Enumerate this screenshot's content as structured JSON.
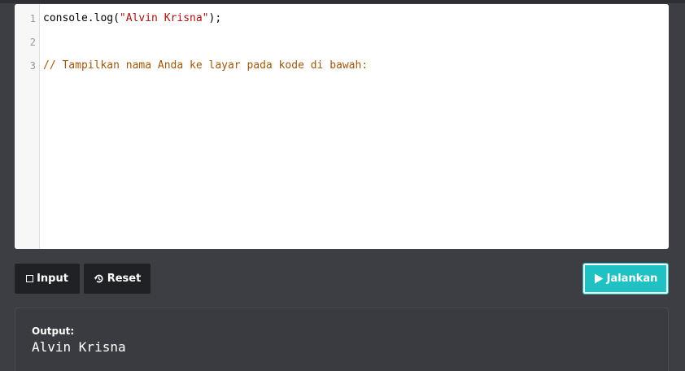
{
  "editor": {
    "lines": [
      {
        "number": "1",
        "code_prefix": "console.log(",
        "code_string": "\"Alvin Krisna\"",
        "code_suffix": ");"
      },
      {
        "number": "2"
      },
      {
        "number": "3",
        "comment": "// Tampilkan nama Anda ke layar pada kode di bawah:"
      }
    ]
  },
  "toolbar": {
    "input_label": "Input",
    "reset_label": "Reset",
    "run_label": "Jalankan"
  },
  "output": {
    "label": "Output:",
    "text": "Alvin Krisna"
  },
  "icons": {
    "input": "square-icon",
    "reset": "history-icon",
    "run": "play-icon"
  },
  "colors": {
    "background": "#3d3e43",
    "button_dark": "#202124",
    "run_button": "#1fc1c3",
    "string": "#aa1111",
    "comment": "#a0570c"
  }
}
